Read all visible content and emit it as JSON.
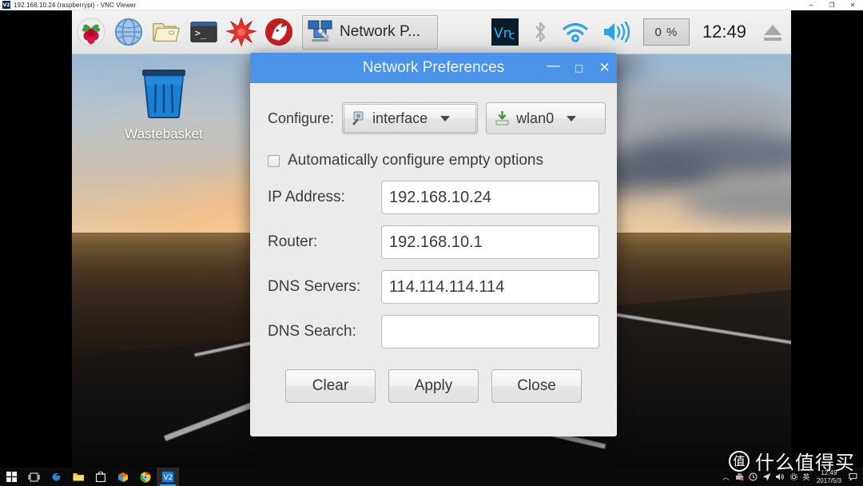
{
  "vnc_window": {
    "title": "192.168.10.24 (raspberrypi) - VNC Viewer",
    "app_icon_label": "V2",
    "controls": {
      "minimize": "−",
      "restore": "❐",
      "close": "✕"
    }
  },
  "pi_panel": {
    "launchers": [
      {
        "name": "raspberry-menu-icon",
        "label": "Menu"
      },
      {
        "name": "web-browser-icon",
        "label": "Web Browser"
      },
      {
        "name": "file-manager-icon",
        "label": "File Manager"
      },
      {
        "name": "terminal-icon",
        "label": "Terminal"
      },
      {
        "name": "mathematica-icon",
        "label": "Mathematica"
      },
      {
        "name": "wolfram-icon",
        "label": "Wolfram"
      }
    ],
    "task_button": {
      "label": "Network P...",
      "icon": "network-preferences-icon"
    },
    "tray": {
      "vnc": "VNC",
      "bluetooth": "Bluetooth",
      "wifi": "Wireless Network",
      "volume": "Volume",
      "cpu_usage": "0 %",
      "clock": "12:49",
      "eject": "Eject"
    }
  },
  "desktop": {
    "wastebasket_label": "Wastebasket"
  },
  "dialog": {
    "title": "Network Preferences",
    "controls": {
      "minimize": "—",
      "maximize": "□",
      "close": "✕"
    },
    "configure_label": "Configure:",
    "interface_select": {
      "value": "interface",
      "icon": "wrench-interface-icon"
    },
    "device_select": {
      "value": "wlan0",
      "icon": "network-device-icon"
    },
    "auto_configure": {
      "label": "Automatically configure empty options",
      "checked": false
    },
    "fields": [
      {
        "label": "IP Address:",
        "value": "192.168.10.24",
        "name": "ip-address"
      },
      {
        "label": "Router:",
        "value": "192.168.10.1",
        "name": "router"
      },
      {
        "label": "DNS Servers:",
        "value": "114.114.114.114",
        "name": "dns-servers"
      },
      {
        "label": "DNS Search:",
        "value": "",
        "name": "dns-search"
      }
    ],
    "buttons": [
      {
        "label": "Clear",
        "name": "clear-button"
      },
      {
        "label": "Apply",
        "name": "apply-button"
      },
      {
        "label": "Close",
        "name": "close-button"
      }
    ]
  },
  "windows_taskbar": {
    "items": [
      {
        "name": "start-button",
        "label": "Start"
      },
      {
        "name": "task-view-button",
        "label": "Task View"
      },
      {
        "name": "edge-icon",
        "label": "Microsoft Edge"
      },
      {
        "name": "file-explorer-icon",
        "label": "File Explorer"
      },
      {
        "name": "store-icon",
        "label": "Microsoft Store"
      },
      {
        "name": "paint3d-icon",
        "label": "Paint 3D"
      },
      {
        "name": "chrome-icon",
        "label": "Google Chrome"
      },
      {
        "name": "vnc-viewer-icon",
        "label": "V2"
      }
    ],
    "tray": {
      "chevron": "︿",
      "time": "12:49",
      "date": "2017/5/3",
      "ime": "英"
    }
  },
  "watermark": {
    "logo": "值",
    "text": "什么值得买"
  },
  "colors": {
    "dialog_titlebar": "#4a93e8",
    "dialog_bg": "#ebebeb",
    "panel_bg": "#ededed",
    "taskbar_bg": "#0a0a0a",
    "accent_blue": "#3a96dd"
  }
}
